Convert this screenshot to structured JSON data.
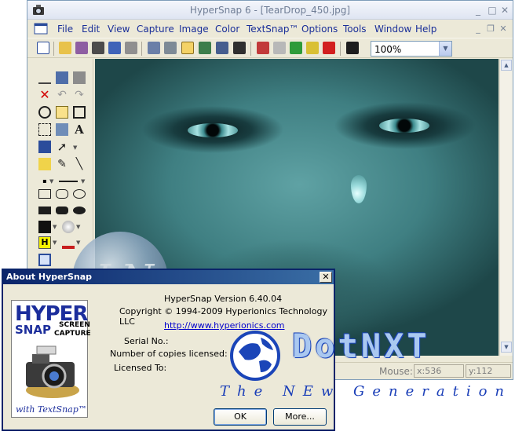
{
  "window": {
    "title": "HyperSnap 6 - [TearDrop_450.jpg]",
    "controls": [
      "minimize-icon",
      "maximize-icon",
      "close-icon"
    ]
  },
  "menu": [
    "File",
    "Edit",
    "View",
    "Capture",
    "Image",
    "Color",
    "TextSnap™",
    "Options",
    "Tools",
    "Window",
    "Help"
  ],
  "toolbar": {
    "zoom_value": "100%",
    "icons": [
      "new-icon",
      "open-icon",
      "save-icon",
      "save-as-icon",
      "book-icon",
      "print-icon",
      "capture-window-icon",
      "properties-icon",
      "capture-region-icon",
      "capture-button-icon",
      "capture-scroll-icon",
      "capture-full-icon",
      "rotate-icon",
      "flip-icon",
      "crop-icon",
      "resize-icon",
      "stamp-icon",
      "whats-this-icon"
    ]
  },
  "tools": [
    "scissors-icon",
    "copy-icon",
    "paste-icon",
    "delete-icon",
    "undo-icon",
    "redo-icon",
    "zoom-icon",
    "pointer-icon",
    "select-icon",
    "marquee-icon",
    "fill-icon",
    "text-icon",
    "eraser-pen-icon",
    "arrow-icon",
    "highlighter-icon",
    "pen-icon",
    "line-icon",
    "dot-icon",
    "line-style-icon",
    "rectangle-icon",
    "rounded-rectangle-icon",
    "ellipse-icon",
    "filled-rectangle-icon",
    "filled-rounded-rectangle-icon",
    "filled-ellipse-icon",
    "color-icon",
    "fill-pattern-icon",
    "highlight-h-icon",
    "stamp-tool-icon",
    "fit-icon"
  ],
  "status": {
    "mouse_label": "Mouse:",
    "x": "x:536",
    "y": "y:112"
  },
  "about": {
    "title": "About HyperSnap",
    "version": "HyperSnap Version 6.40.04",
    "copyright": "Copyright © 1994-2009 Hyperionics Technology LLC",
    "url": "http://www.hyperionics.com",
    "serial_label": "Serial No.:",
    "copies_label": "Number of copies licensed: 1",
    "licensed_label": "Licensed To:",
    "logo_hyper": "HYPER",
    "logo_snap": "SNAP",
    "logo_screen": "SCREEN",
    "logo_capture": "CAPTURE",
    "logo_with": "with TextSnap™",
    "ok_label": "OK",
    "more_label": "More..."
  },
  "watermark": {
    "letters": "LN",
    "brand": "DotNXT",
    "tagline": "The NEw Generation"
  },
  "colors": {
    "menu_text": "#1a2f99",
    "dialog_title": "#0a246a",
    "link": "#0000cc",
    "brand": "#1b3fb8"
  }
}
